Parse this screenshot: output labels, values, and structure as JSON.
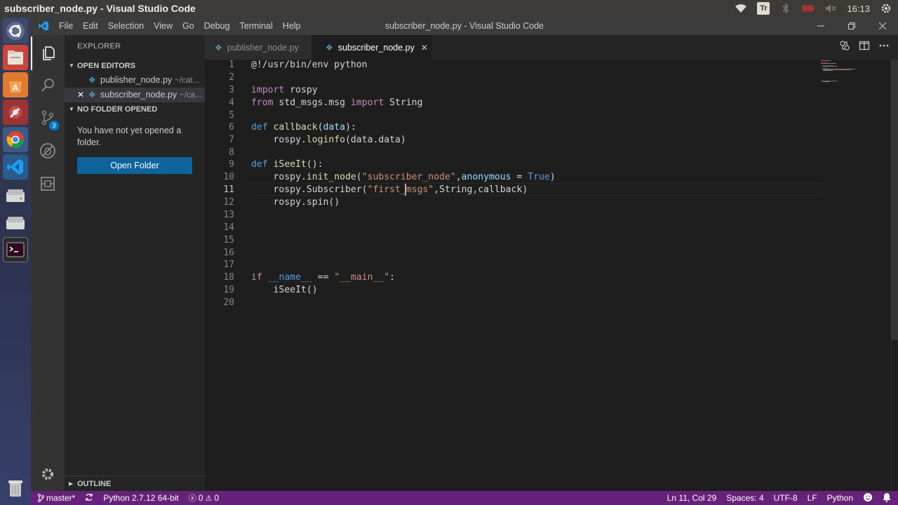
{
  "os_panel": {
    "window_title": "subscriber_node.py - Visual Studio Code",
    "keyboard_indicator": "Tr",
    "clock": "16:13"
  },
  "titlebar": {
    "menu": [
      "File",
      "Edit",
      "Selection",
      "View",
      "Go",
      "Debug",
      "Terminal",
      "Help"
    ],
    "title": "subscriber_node.py - Visual Studio Code"
  },
  "activity": {
    "scm_badge": "3"
  },
  "sidebar": {
    "title": "EXPLORER",
    "open_editors_label": "OPEN EDITORS",
    "open_editors": [
      {
        "name": "publisher_node.py",
        "path": "~/cat..."
      },
      {
        "name": "subscriber_node.py",
        "path": "~/ca..."
      }
    ],
    "no_folder_label": "NO FOLDER OPENED",
    "no_folder_message": "You have not yet opened a folder.",
    "open_folder_button": "Open Folder",
    "outline_label": "OUTLINE"
  },
  "tabs": [
    {
      "label": "publisher_node.py",
      "active": false
    },
    {
      "label": "subscriber_node.py",
      "active": true
    }
  ],
  "editor": {
    "current_line": 11,
    "line_numbers": [
      "1",
      "2",
      "3",
      "4",
      "5",
      "6",
      "7",
      "8",
      "9",
      "10",
      "11",
      "12",
      "13",
      "14",
      "15",
      "16",
      "17",
      "18",
      "19",
      "20"
    ],
    "lines": {
      "l1": "@!/usr/bin/env python",
      "l3_kw": "import",
      "l3_rest": " rospy",
      "l4_kw1": "from",
      "l4_mid": " std_msgs.msg ",
      "l4_kw2": "import",
      "l4_rest": " String",
      "l6_def": "def",
      "l6_fn": "callback",
      "l6_p1": "(",
      "l6_param": "data",
      "l6_p2": "):",
      "l7_a": "    rospy.",
      "l7_fn": "loginfo",
      "l7_b": "(data.data)",
      "l9_def": "def",
      "l9_fn": "iSeeIt",
      "l9_b": "():",
      "l10_a": "    rospy.",
      "l10_fn": "init_node",
      "l10_b": "(",
      "l10_str": "\"subscriber_node\"",
      "l10_c": ",",
      "l10_param": "anonymous",
      "l10_d": " = ",
      "l10_const": "True",
      "l10_e": ")",
      "l11_a": "    rospy.",
      "l11_fn": "Subscriber",
      "l11_b": "(",
      "l11_str": "\"first_msgs\"",
      "l11_c": ",String,callback)",
      "l12_a": "    rospy.",
      "l12_fn": "spin",
      "l12_b": "()",
      "l18_kw": "if",
      "l18_a": " ",
      "l18_name": "__name__",
      "l18_b": " == ",
      "l18_str": "\"__main__\"",
      "l18_c": ":",
      "l19_a": "    ",
      "l19_fn": "iSeeIt",
      "l19_b": "()"
    }
  },
  "statusbar": {
    "branch": "master*",
    "interpreter": "Python 2.7.12 64-bit",
    "errors": "0",
    "warnings": "0",
    "position": "Ln 11, Col 29",
    "spaces": "Spaces: 4",
    "encoding": "UTF-8",
    "eol": "LF",
    "language": "Python"
  }
}
